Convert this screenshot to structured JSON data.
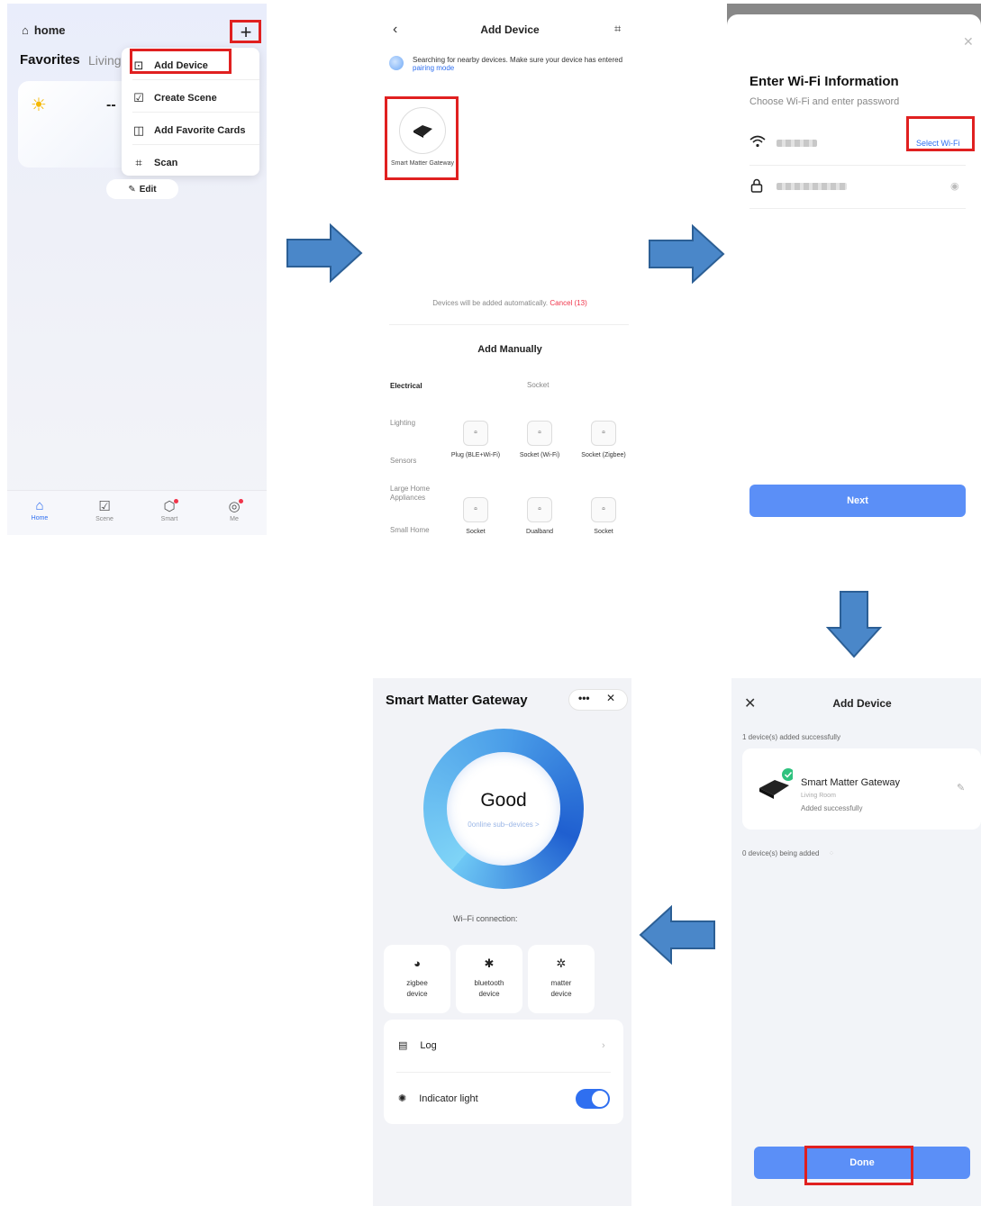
{
  "colors": {
    "accent": "#2f6ff0",
    "button": "#5b8ff7",
    "highlight": "#e02020",
    "arrow": "#4a87c9"
  },
  "panel_home": {
    "title": "home",
    "favorites": "Favorites",
    "living": "Living",
    "weather_value": "--",
    "menu": [
      {
        "label": "Add Device",
        "icon": "add-device-icon"
      },
      {
        "label": "Create Scene",
        "icon": "create-scene-icon"
      },
      {
        "label": "Add Favorite Cards",
        "icon": "add-card-icon"
      },
      {
        "label": "Scan",
        "icon": "scan-icon"
      }
    ],
    "edit": "Edit",
    "tabs": [
      "Home",
      "Scene",
      "Smart",
      "Me"
    ]
  },
  "panel_add_device": {
    "title": "Add Device",
    "searching": "Searching for nearby devices. Make sure your device has entered",
    "pairing_mode": "pairing mode",
    "found_device": "Smart Matter Gateway",
    "auto_added": "Devices will be added automatically.",
    "cancel": "Cancel (13)",
    "add_manually": "Add Manually",
    "categories": [
      "Electrical",
      "Lighting",
      "Sensors",
      "Large Home Appliances",
      "Small Home"
    ],
    "category_header": "Socket",
    "sockets_row1": [
      "Plug (BLE+Wi-Fi)",
      "Socket (Wi-Fi)",
      "Socket (Zigbee)"
    ],
    "sockets_row2": [
      "Socket",
      "Dualband",
      "Socket"
    ]
  },
  "panel_wifi": {
    "title": "Enter Wi-Fi Information",
    "subtitle": "Choose Wi-Fi and enter password",
    "select_wifi": "Select Wi-Fi",
    "next": "Next"
  },
  "panel_done": {
    "title": "Add Device",
    "added_count": "1 device(s) added successfully",
    "device_name": "Smart Matter Gateway",
    "room": "Living Room",
    "status": "Added successfully",
    "adding_count": "0 device(s) being added",
    "done": "Done"
  },
  "panel_gateway": {
    "title": "Smart Matter Gateway",
    "more": "•••",
    "close": "✕",
    "status": "Good",
    "subdevices": "0online sub–devices >",
    "wifi_connection": "Wi–Fi connection:",
    "tiles": [
      {
        "label1": "zigbee",
        "label2": "device"
      },
      {
        "label1": "bluetooth",
        "label2": "device"
      },
      {
        "label1": "matter",
        "label2": "device"
      }
    ],
    "log": "Log",
    "indicator": "Indicator light"
  }
}
